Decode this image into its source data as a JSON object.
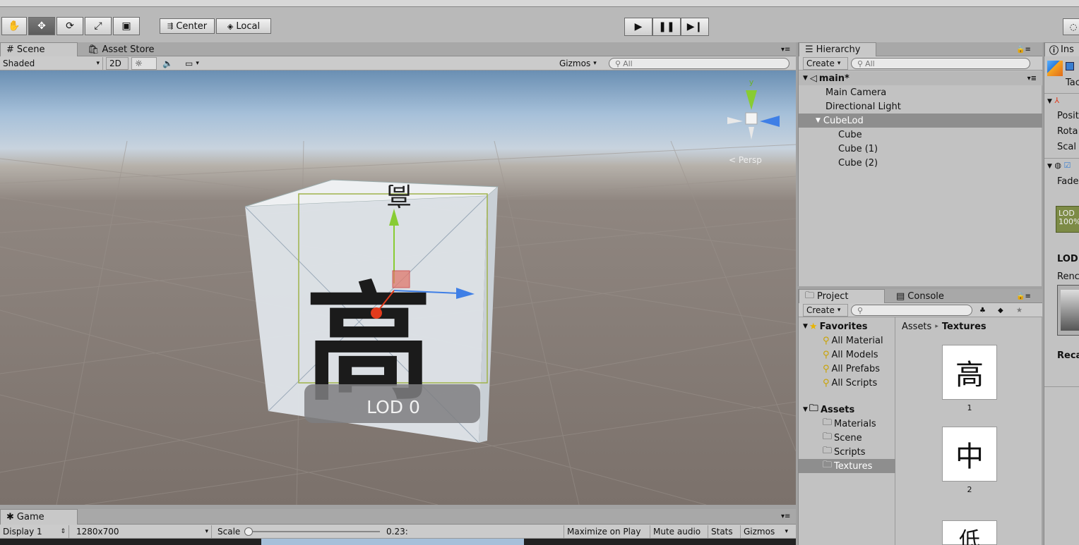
{
  "toolbar": {
    "tools": [
      "hand-tool",
      "move-tool",
      "rotate-tool",
      "scale-tool",
      "rect-tool"
    ],
    "pivot_label": "Center",
    "space_label": "Local"
  },
  "scene": {
    "tab_scene": "Scene",
    "tab_asset_store": "Asset Store",
    "shading_mode": "Shaded",
    "mode_2d": "2D",
    "gizmos_label": "Gizmos",
    "search_placeholder": "All",
    "axis_y": "y",
    "persp_label": "< Persp",
    "lod_label": "LOD 0",
    "cube_glyph_front": "高",
    "cube_glyph_top": "高"
  },
  "hierarchy": {
    "title": "Hierarchy",
    "create_label": "Create",
    "search_placeholder": "All",
    "scene_name": "main*",
    "items": [
      "Main Camera",
      "Directional Light",
      "CubeLod",
      "Cube",
      "Cube (1)",
      "Cube (2)"
    ]
  },
  "project": {
    "tab_project": "Project",
    "tab_console": "Console",
    "create_label": "Create",
    "favorites_label": "Favorites",
    "favorites": [
      "All Material",
      "All Models",
      "All Prefabs",
      "All Scripts"
    ],
    "assets_label": "Assets",
    "folders": [
      "Materials",
      "Scene",
      "Scripts",
      "Textures"
    ],
    "breadcrumb_root": "Assets",
    "breadcrumb_sep": "▸",
    "breadcrumb_current": "Textures",
    "textures": [
      {
        "glyph": "高",
        "label": "1"
      },
      {
        "glyph": "中",
        "label": "2"
      },
      {
        "glyph": "低",
        "label": ""
      }
    ]
  },
  "inspector": {
    "title": "Ins",
    "tag_label": "Tac",
    "posit": "Posit",
    "rota": "Rota",
    "scale": "Scal",
    "fade": "Fade",
    "lod_line1": "LOD",
    "lod_line2": "100%",
    "lod_heading": "LOD",
    "renderers": "Renc",
    "recalc": "Reca"
  },
  "game": {
    "tab": "Game",
    "display": "Display 1",
    "resolution": "1280x700",
    "scale_label": "Scale",
    "scale_value": "0.23:",
    "maximize": "Maximize on Play",
    "mute": "Mute audio",
    "stats": "Stats",
    "gizmos": "Gizmos"
  },
  "colors": {
    "selected_row": "#8e8e8e",
    "lod_badge": "#7d8b46",
    "gizmo_y": "#88cc33",
    "gizmo_x": "#3f7fe6",
    "gizmo_z": "#e23a1c"
  }
}
